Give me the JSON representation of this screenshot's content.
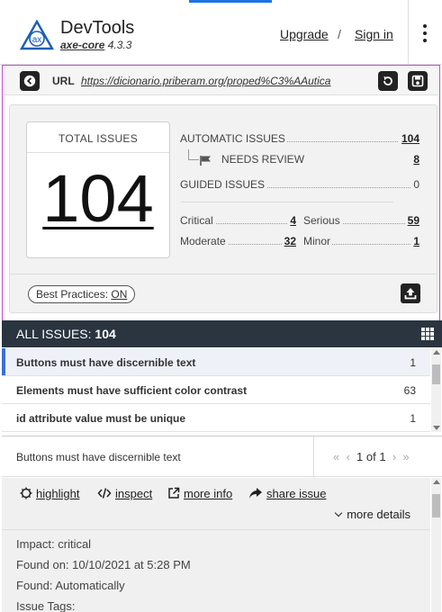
{
  "header": {
    "title": "DevTools",
    "subtitle_core": "axe-core",
    "subtitle_version": "4.3.3",
    "upgrade": "Upgrade",
    "separator": "/",
    "sign_in": "Sign in",
    "logo_text": "ax"
  },
  "url_bar": {
    "label": "URL",
    "value": "https://dicionario.priberam.org/proped%C3%AAutica"
  },
  "summary": {
    "total_label": "TOTAL ISSUES",
    "total_value": "104",
    "automatic_label": "AUTOMATIC ISSUES",
    "automatic_value": "104",
    "needs_review_label": "NEEDS REVIEW",
    "needs_review_value": "8",
    "guided_label": "GUIDED ISSUES",
    "guided_value": "0",
    "critical_label": "Critical",
    "critical_value": "4",
    "serious_label": "Serious",
    "serious_value": "59",
    "moderate_label": "Moderate",
    "moderate_value": "32",
    "minor_label": "Minor",
    "minor_value": "1",
    "best_practices_label": "Best Practices:",
    "best_practices_value": "ON"
  },
  "issues": {
    "header_label": "ALL ISSUES:",
    "header_count": "104",
    "rows": [
      {
        "name": "Buttons must have discernible text",
        "count": "1"
      },
      {
        "name": "Elements must have sufficient color contrast",
        "count": "63"
      },
      {
        "name": "id attribute value must be unique",
        "count": "1"
      }
    ]
  },
  "detail": {
    "title": "Buttons must have discernible text",
    "pager_text": "1 of 1",
    "actions": {
      "highlight": "highlight",
      "inspect": "inspect",
      "more_info": "more info",
      "share_issue": "share issue"
    },
    "more_details": "more details",
    "impact": "Impact: critical",
    "found_on": "Found on: 10/10/2021 at 5:28 PM",
    "found": "Found: Automatically",
    "issue_tags": "Issue Tags:"
  },
  "colors": {
    "accent_blue": "#1a73e8",
    "frame_purple": "#c24bd6",
    "issues_bar": "#2a3540",
    "active_row_marker": "#3a6fd8"
  },
  "icons": {
    "back": "back-arrow-icon",
    "rerun": "rerun-icon",
    "save": "save-icon",
    "export": "export-icon",
    "grid": "grid-icon",
    "flag": "flag-icon",
    "menu": "kebab-menu-icon"
  }
}
